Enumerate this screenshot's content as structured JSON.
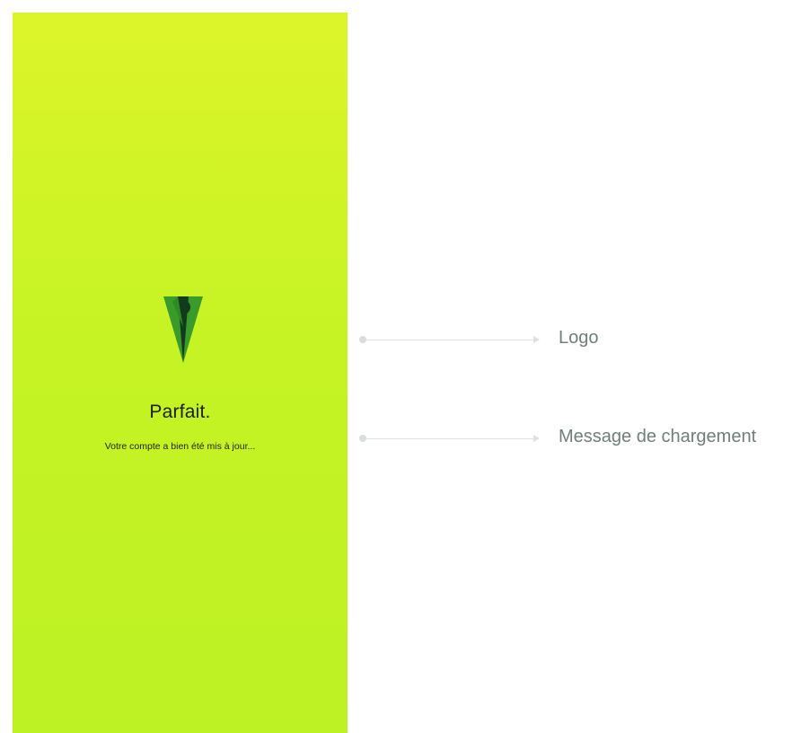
{
  "screen": {
    "title": "Parfait.",
    "subtitle": "Votre compte a bien été mis à jour...",
    "logo_icon": "v-person-logo-icon",
    "colors": {
      "background_top": "#dcf52a",
      "background_bottom": "#bdf224",
      "logo_green": "#3a9a2b",
      "logo_dark": "#123b1d"
    }
  },
  "annotations": [
    {
      "label": "Logo"
    },
    {
      "label": "Message de chargement"
    }
  ]
}
